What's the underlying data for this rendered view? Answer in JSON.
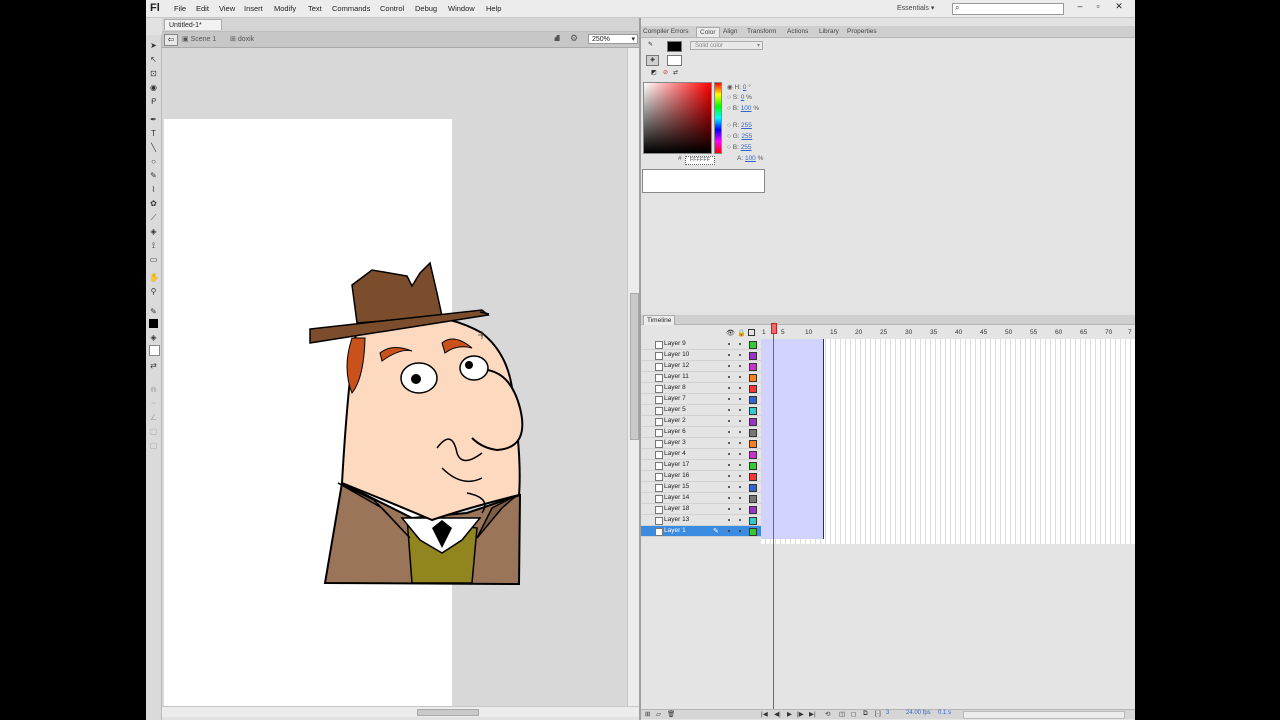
{
  "app": {
    "logo": "Fl",
    "workspace": "Essentials"
  },
  "menu": [
    "File",
    "Edit",
    "View",
    "Insert",
    "Modify",
    "Text",
    "Commands",
    "Control",
    "Debug",
    "Window",
    "Help"
  ],
  "window_controls": [
    "–",
    "▫",
    "✕"
  ],
  "document": {
    "tab": "Untitled-1*",
    "scene": "Scene 1",
    "symbol": "doxik",
    "zoom": "250%"
  },
  "panels": {
    "tabs": [
      "Compiler Errors",
      "Color",
      "Align",
      "Transform",
      "Actions",
      "Library",
      "Properties"
    ],
    "active_tab": "Color"
  },
  "color": {
    "fill_type": "Solid color",
    "H": "0",
    "H_unit": "°",
    "S": "0",
    "S_unit": "%",
    "B": "100",
    "B_unit": "%",
    "R": "255",
    "G": "255",
    "Bv": "255",
    "A": "100",
    "A_unit": "%",
    "hex": "FFFFFF",
    "stroke_color": "#000000",
    "fill_color": "#ffffff"
  },
  "timeline": {
    "tab": "Timeline",
    "frame_numbers": [
      "1",
      "5",
      "10",
      "15",
      "20",
      "25",
      "30",
      "35",
      "40",
      "45",
      "50",
      "55",
      "60",
      "65",
      "70",
      "7"
    ],
    "layers": [
      {
        "name": "Layer 9",
        "color": "#33cc33"
      },
      {
        "name": "Layer 10",
        "color": "#9933cc"
      },
      {
        "name": "Layer 12",
        "color": "#cc33cc"
      },
      {
        "name": "Layer 11",
        "color": "#ff7f1a"
      },
      {
        "name": "Layer 8",
        "color": "#ff3333"
      },
      {
        "name": "Layer 7",
        "color": "#3366cc"
      },
      {
        "name": "Layer 5",
        "color": "#33cccc"
      },
      {
        "name": "Layer 2",
        "color": "#9933cc"
      },
      {
        "name": "Layer 6",
        "color": "#777777"
      },
      {
        "name": "Layer 3",
        "color": "#ff7f1a"
      },
      {
        "name": "Layer 4",
        "color": "#cc33cc"
      },
      {
        "name": "Layer 17",
        "color": "#33cc33"
      },
      {
        "name": "Layer 16",
        "color": "#ff3333"
      },
      {
        "name": "Layer 15",
        "color": "#3366cc"
      },
      {
        "name": "Layer 14",
        "color": "#777777"
      },
      {
        "name": "Layer 18",
        "color": "#9933cc"
      },
      {
        "name": "Layer 13",
        "color": "#33cccc"
      },
      {
        "name": "Layer 1",
        "color": "#33cc33",
        "selected": true
      }
    ],
    "footer": {
      "frame": "3",
      "fps": "24.00 fps",
      "time": "0.1 s"
    }
  }
}
